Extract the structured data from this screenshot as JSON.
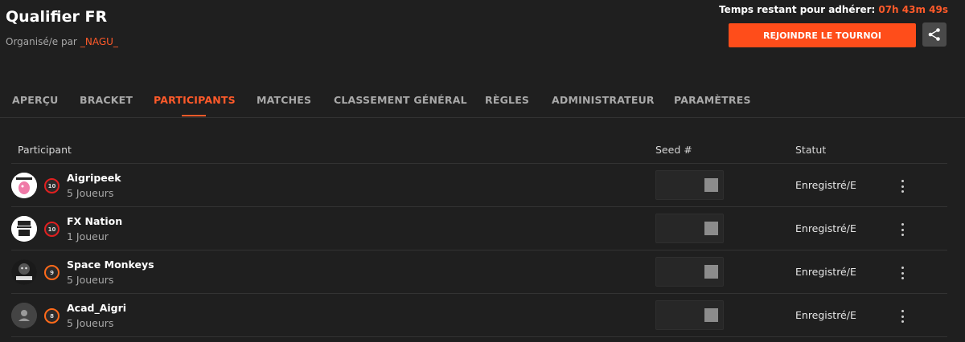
{
  "header": {
    "title": "Qualifier FR",
    "organized_by_label": "Organisé/e par",
    "organizer_name": "_NAGU_",
    "time_label": "Temps restant pour adhérer:",
    "time_value": "07h 43m 49s",
    "join_button": "REJOINDRE LE TOURNOI",
    "share_icon": "share-icon"
  },
  "tabs": [
    {
      "label": "APERÇU",
      "active": false
    },
    {
      "label": "BRACKET",
      "active": false
    },
    {
      "label": "PARTICIPANTS",
      "active": true
    },
    {
      "label": "MATCHES",
      "active": false
    },
    {
      "label": "CLASSEMENT GÉNÉRAL",
      "active": false
    },
    {
      "label": "RÈGLES",
      "active": false
    },
    {
      "label": "ADMINISTRATEUR",
      "active": false
    },
    {
      "label": "PARAMÈTRES",
      "active": false
    }
  ],
  "table": {
    "columns": [
      "Participant",
      "Seed #",
      "Statut"
    ],
    "rows": [
      {
        "name": "Aigripeek",
        "players": "5 Joueurs",
        "level": "10",
        "status": "Enregistré/E",
        "avatar": "team-logo-aigripeek"
      },
      {
        "name": "FX Nation",
        "players": "1 Joueur",
        "level": "10",
        "status": "Enregistré/E",
        "avatar": "team-logo-fx-nation"
      },
      {
        "name": "Space Monkeys",
        "players": "5 Joueurs",
        "level": "9",
        "status": "Enregistré/E",
        "avatar": "team-logo-space-monkeys"
      },
      {
        "name": "Acad_Aigri",
        "players": "5 Joueurs",
        "level": "8",
        "status": "Enregistré/E",
        "avatar": "default-user-icon"
      }
    ]
  },
  "colors": {
    "accent": "#ff5a2a",
    "background": "#1f1f1f",
    "badge_high": "#e02020",
    "badge_mid": "#ff6a1a"
  }
}
